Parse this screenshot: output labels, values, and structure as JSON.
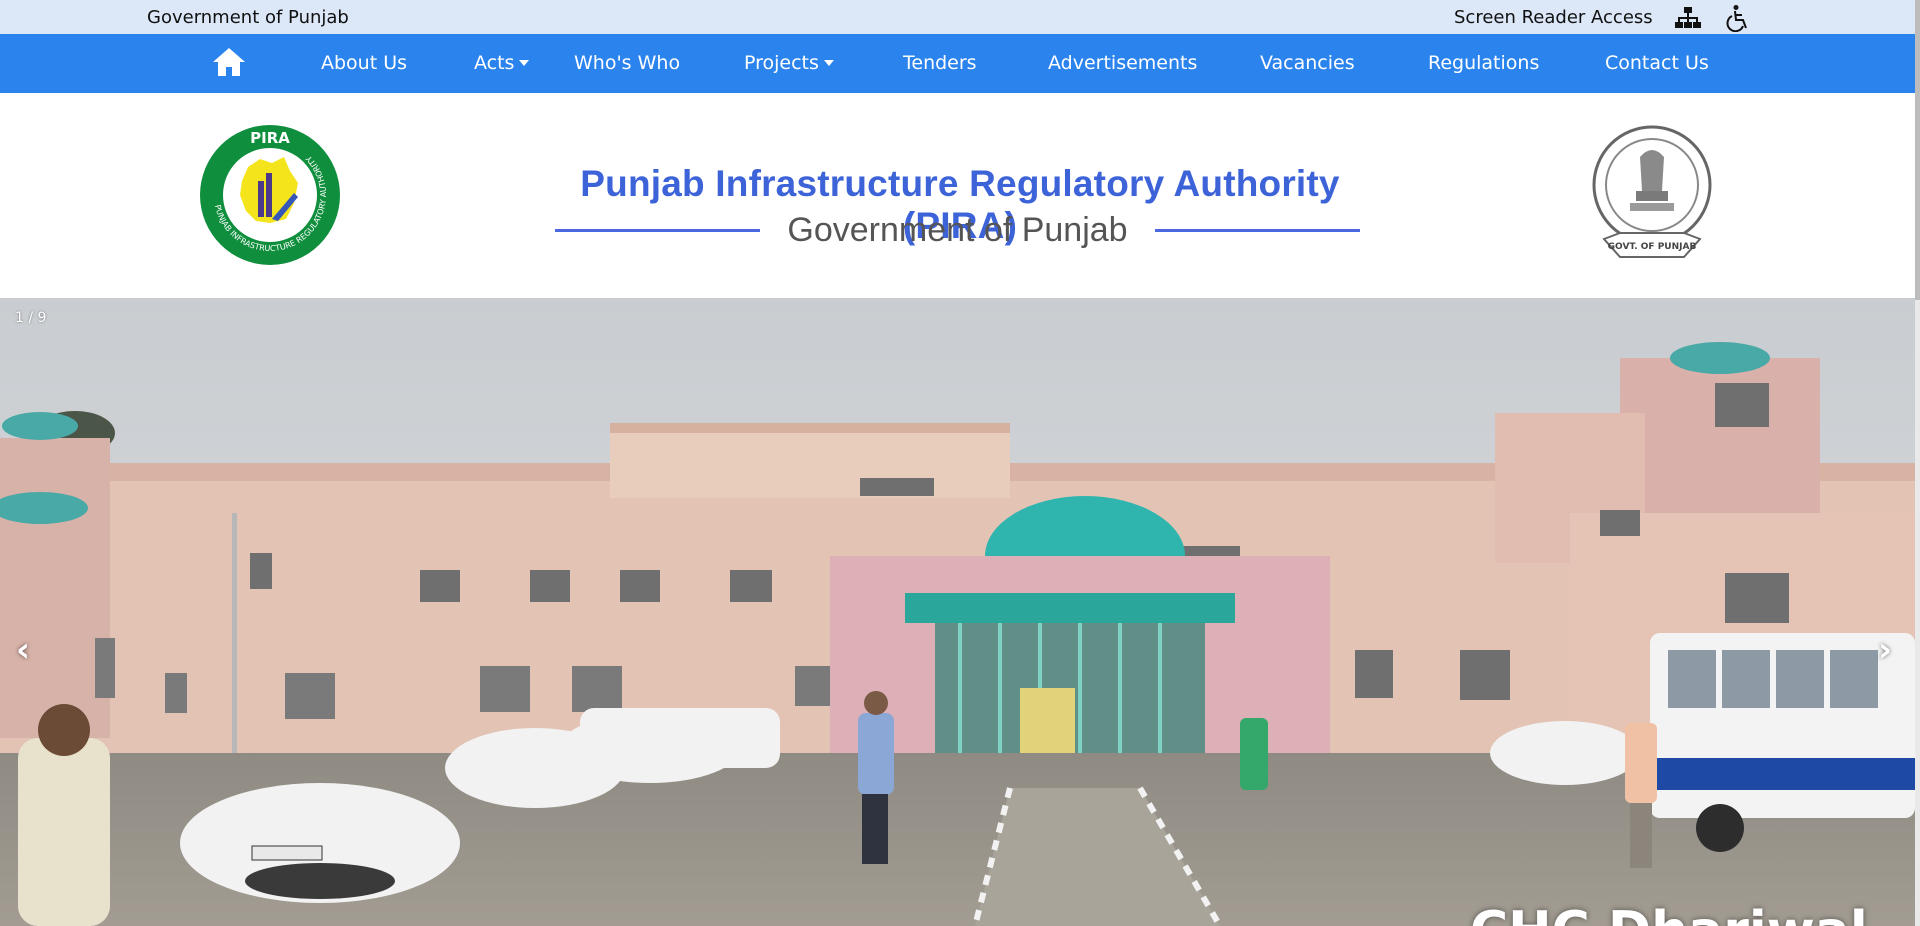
{
  "topbar": {
    "gov_label": "Government of Punjab",
    "screen_reader_label": "Screen Reader Access",
    "sitemap_icon": "sitemap-icon",
    "accessibility_icon": "wheelchair-icon"
  },
  "nav": {
    "home_icon": "home-icon",
    "items": [
      {
        "label": "About Us",
        "dropdown": false
      },
      {
        "label": "Acts",
        "dropdown": true
      },
      {
        "label": "Who's Who",
        "dropdown": false
      },
      {
        "label": "Projects",
        "dropdown": true
      },
      {
        "label": "Tenders",
        "dropdown": false
      },
      {
        "label": "Advertisements",
        "dropdown": false
      },
      {
        "label": "Vacancies",
        "dropdown": false
      },
      {
        "label": "Regulations",
        "dropdown": false
      },
      {
        "label": "Contact Us",
        "dropdown": false
      }
    ]
  },
  "header": {
    "title": "Punjab Infrastructure Regulatory Authority (PIRA)",
    "subtitle": "Government of Punjab",
    "logo_text": "PIRA",
    "logo_ring_text": "PUNJAB INFRASTRUCTURE REGULATORY AUTHORITY",
    "emblem_text": "GOVT. OF PUNJAB"
  },
  "slider": {
    "counter": "1 / 9",
    "prev_label": "‹",
    "next_label": "›",
    "caption": "CHC Dhariwal"
  },
  "colors": {
    "topbar_bg": "#dce7f7",
    "nav_bg": "#2b84ed",
    "title_blue": "#3d63d9",
    "logo_green": "#0f8f3d"
  }
}
